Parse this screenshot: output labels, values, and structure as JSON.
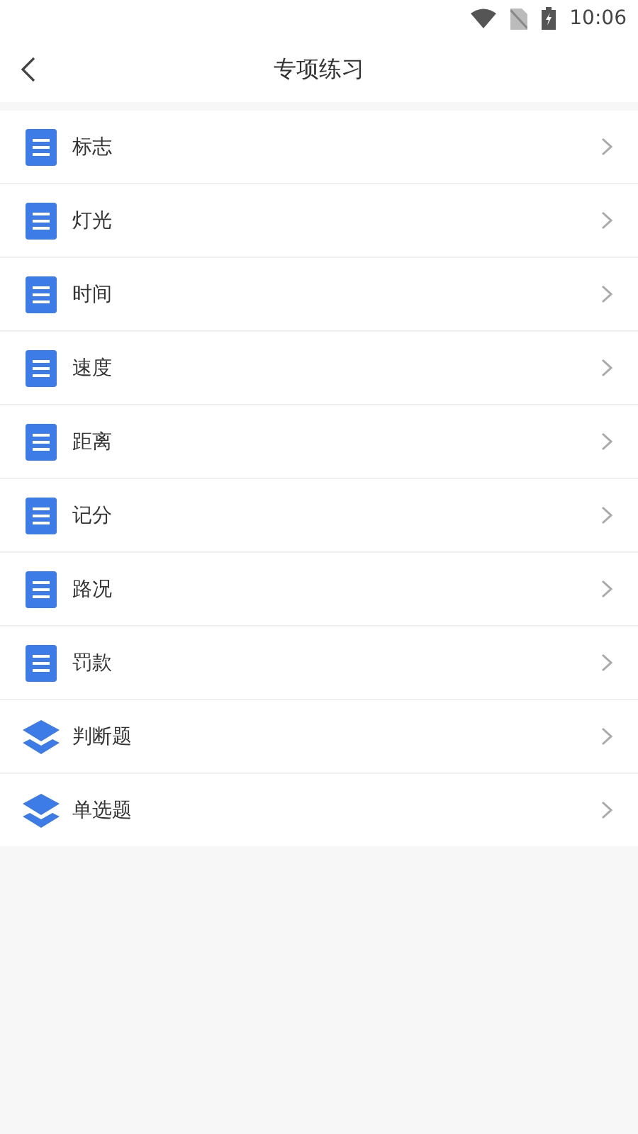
{
  "status_bar": {
    "time": "10:06"
  },
  "header": {
    "title": "专项练习"
  },
  "items": [
    {
      "label": "标志",
      "kind": "document"
    },
    {
      "label": "灯光",
      "kind": "document"
    },
    {
      "label": "时间",
      "kind": "document"
    },
    {
      "label": "速度",
      "kind": "document"
    },
    {
      "label": "距离",
      "kind": "document"
    },
    {
      "label": "记分",
      "kind": "document"
    },
    {
      "label": "路况",
      "kind": "document"
    },
    {
      "label": "罚款",
      "kind": "document"
    },
    {
      "label": "判断题",
      "kind": "layers"
    },
    {
      "label": "单选题",
      "kind": "layers"
    }
  ]
}
